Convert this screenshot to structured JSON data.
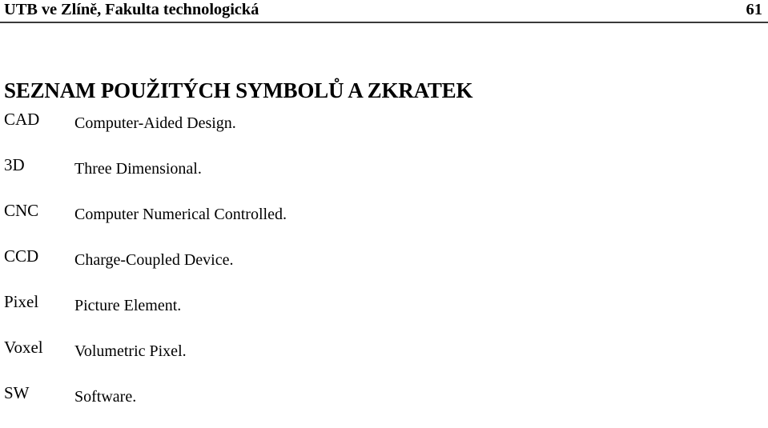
{
  "header": {
    "title": "UTB ve Zlíně, Fakulta technologická",
    "page_number": "61"
  },
  "section": {
    "title": "SEZNAM POUŽITÝCH SYMBOLŮ A ZKRATEK"
  },
  "abbreviations": [
    {
      "term": "CAD",
      "definition": "Computer-Aided Design."
    },
    {
      "term": "3D",
      "definition": "Three Dimensional."
    },
    {
      "term": "CNC",
      "definition": "Computer Numerical Controlled."
    },
    {
      "term": "CCD",
      "definition": "Charge-Coupled Device."
    },
    {
      "term": "Pixel",
      "definition": "Picture Element."
    },
    {
      "term": "Voxel",
      "definition": "Volumetric Pixel."
    },
    {
      "term": "SW",
      "definition": "Software."
    }
  ],
  "colors": {
    "text": "#000000",
    "rule": "#3a3a3a",
    "background": "#ffffff"
  }
}
